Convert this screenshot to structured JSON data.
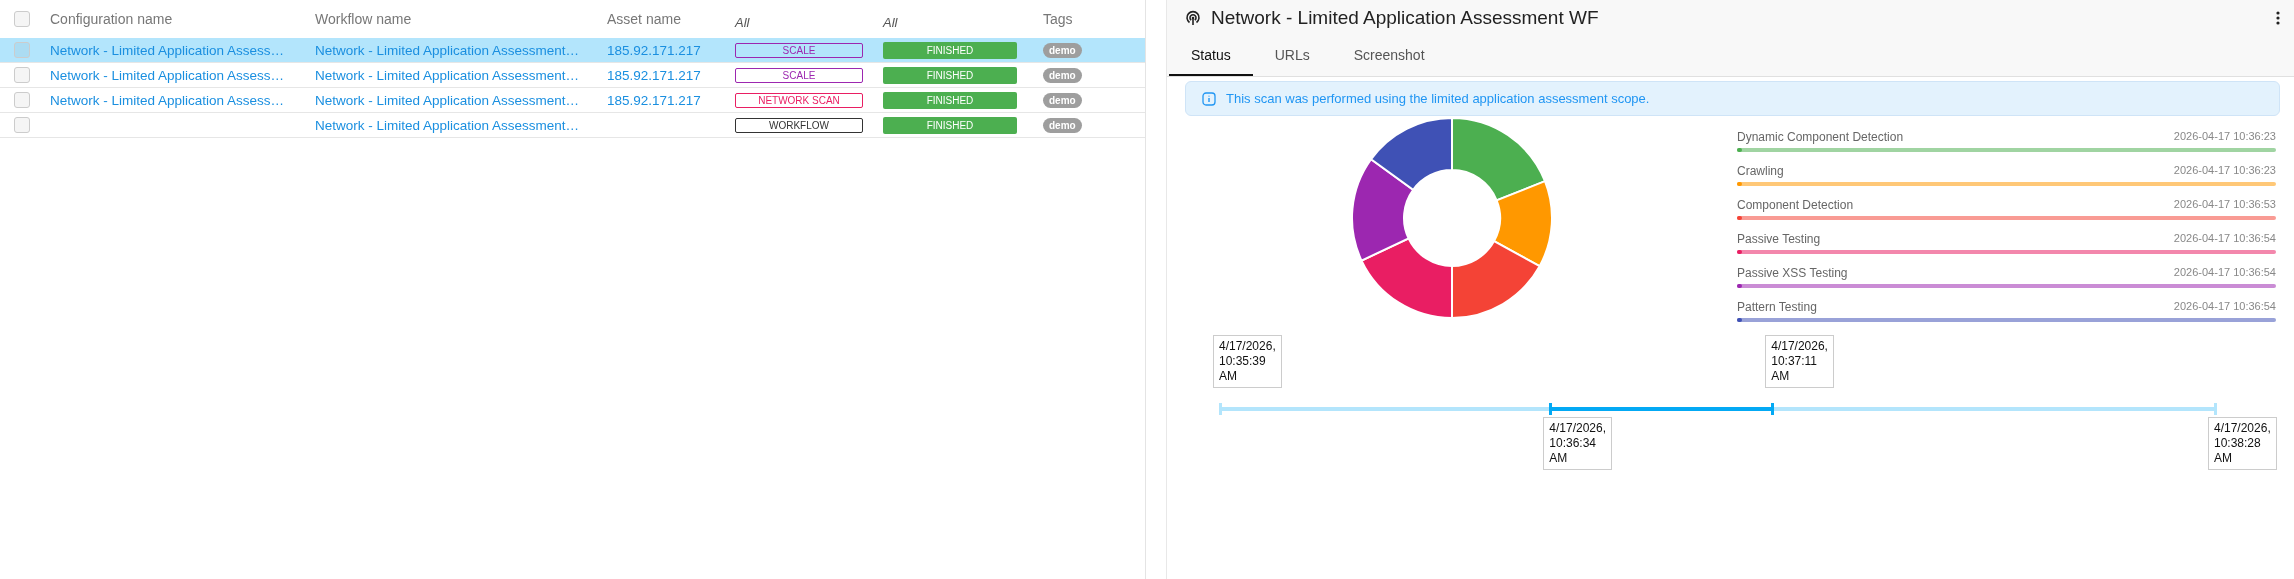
{
  "table": {
    "header_checkbox": {
      "checked": false
    },
    "columns": [
      {
        "label": "Configuration name"
      },
      {
        "label": "Workflow name"
      },
      {
        "label": "Asset name"
      },
      {
        "filter": "All"
      },
      {
        "filter": "All"
      },
      {
        "label": "Tags"
      }
    ],
    "rows": [
      {
        "selected": true,
        "checked": false,
        "configuration": "Network - Limited Application Assess…",
        "workflow": "Network - Limited Application Assessment…",
        "asset": "185.92.171.217",
        "source": {
          "label": "SCALE",
          "color": "#9c27b0"
        },
        "status": "FINISHED",
        "tag": "demo"
      },
      {
        "selected": false,
        "checked": false,
        "configuration": "Network - Limited Application Assess…",
        "workflow": "Network - Limited Application Assessment…",
        "asset": "185.92.171.217",
        "source": {
          "label": "SCALE",
          "color": "#9c27b0"
        },
        "status": "FINISHED",
        "tag": "demo"
      },
      {
        "selected": false,
        "checked": false,
        "configuration": "Network - Limited Application Assess…",
        "workflow": "Network - Limited Application Assessment…",
        "asset": "185.92.171.217",
        "source": {
          "label": "NETWORK SCAN",
          "color": "#e91e63"
        },
        "status": "FINISHED",
        "tag": "demo"
      },
      {
        "selected": false,
        "checked": false,
        "workflow": "Network - Limited Application Assessment…",
        "source": {
          "label": "WORKFLOW",
          "color": "#333333"
        },
        "status": "FINISHED",
        "tag": "demo"
      }
    ]
  },
  "detail": {
    "title": "Network - Limited Application Assessment WF",
    "tabs": [
      {
        "label": "Status",
        "selected": true
      },
      {
        "label": "URLs",
        "selected": false
      },
      {
        "label": "Screenshot",
        "selected": false
      }
    ],
    "info": "This scan was performed using the limited application assessment scope.",
    "phases": [
      {
        "label": "Dynamic Component Detection",
        "time": "2026-04-17 10:36:23",
        "color": "#4caf50"
      },
      {
        "label": "Crawling",
        "time": "2026-04-17 10:36:23",
        "color": "#ff9800"
      },
      {
        "label": "Component Detection",
        "time": "2026-04-17 10:36:53",
        "color": "#f44336"
      },
      {
        "label": "Passive Testing",
        "time": "2026-04-17 10:36:54",
        "color": "#e91e63"
      },
      {
        "label": "Passive XSS Testing",
        "time": "2026-04-17 10:36:54",
        "color": "#9c27b0"
      },
      {
        "label": "Pattern Testing",
        "time": "2026-04-17 10:36:54",
        "color": "#3f51b5"
      }
    ],
    "timeline": [
      {
        "lines": [
          "4/17/2026,",
          "10:35:39",
          "AM"
        ]
      },
      {
        "lines": [
          "4/17/2026,",
          "10:36:34",
          "AM"
        ]
      },
      {
        "lines": [
          "4/17/2026,",
          "10:37:11",
          "AM"
        ]
      },
      {
        "lines": [
          "4/17/2026,",
          "10:38:28",
          "AM"
        ]
      }
    ]
  }
}
